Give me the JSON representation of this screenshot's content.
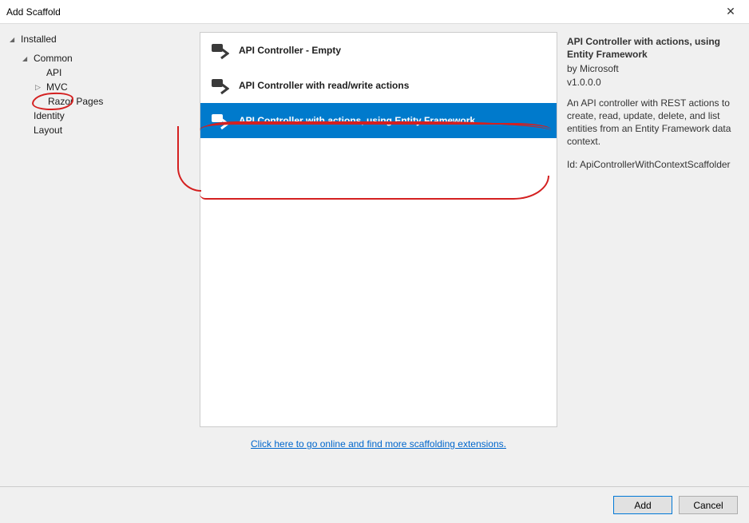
{
  "window": {
    "title": "Add Scaffold"
  },
  "sidebar": {
    "root": "Installed",
    "common": "Common",
    "api": "API",
    "mvc": "MVC",
    "razor": "Razor Pages",
    "identity": "Identity",
    "layout": "Layout"
  },
  "list": {
    "items": [
      {
        "label": "API Controller - Empty",
        "selected": false
      },
      {
        "label": "API Controller with read/write actions",
        "selected": false
      },
      {
        "label": "API Controller with actions, using Entity Framework",
        "selected": true
      }
    ]
  },
  "online_link": "Click here to go online and find more scaffolding extensions.",
  "details": {
    "title": "API Controller with actions, using Entity Framework",
    "by": "by Microsoft",
    "version": "v1.0.0.0",
    "description": "An API controller with REST actions to create, read, update, delete, and list entities from an Entity Framework data context.",
    "id_label": "Id: ApiControllerWithContextScaffolder"
  },
  "footer": {
    "add": "Add",
    "cancel": "Cancel"
  }
}
